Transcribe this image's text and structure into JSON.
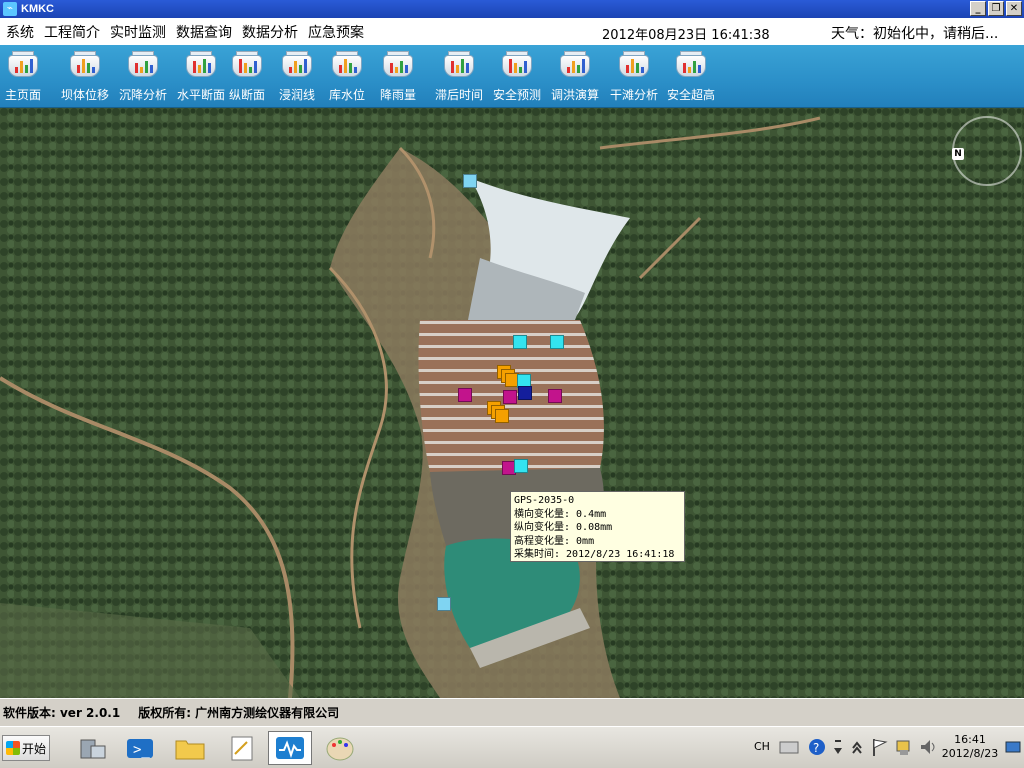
{
  "app": {
    "title": "KMKC"
  },
  "window_controls": {
    "minimize": "_",
    "restore": "❐",
    "close": "✕"
  },
  "menu": {
    "items": [
      "系统",
      "工程简介",
      "实时监测",
      "数据查询",
      "数据分析",
      "应急预案"
    ],
    "datetime": "2012年08月23日  16:41:38",
    "weather": "天气：初始化中，请稍后..."
  },
  "toolbar": {
    "buttons": [
      "主页面",
      "坝体位移",
      "沉降分析",
      "水平断面",
      "纵断面",
      "浸润线",
      "库水位",
      "降雨量",
      "滞后时间",
      "安全预测",
      "调洪演算",
      "干滩分析",
      "安全超高"
    ],
    "icon": "bar-chart-icon"
  },
  "map": {
    "compass_label": "N",
    "marker_colors": {
      "cyan": "#33e4f0",
      "lightblue": "#7fd4f2",
      "magenta": "#c2148c",
      "orange": "#f5a000",
      "navy": "#141e9c"
    },
    "tooltip": {
      "id": "GPS-2035-0",
      "lines": [
        "横向变化量: 0.4mm",
        "纵向变化量: 0.08mm",
        "高程变化量: 0mm",
        "采集时间: 2012/8/23 16:41:18"
      ]
    }
  },
  "status": {
    "version": "软件版本: ver 2.0.1",
    "copyright": "版权所有: 广州南方测绘仪器有限公司"
  },
  "taskbar": {
    "start_label": "开始",
    "language": "CH",
    "clock_time": "16:41",
    "clock_date": "2012/8/23"
  }
}
